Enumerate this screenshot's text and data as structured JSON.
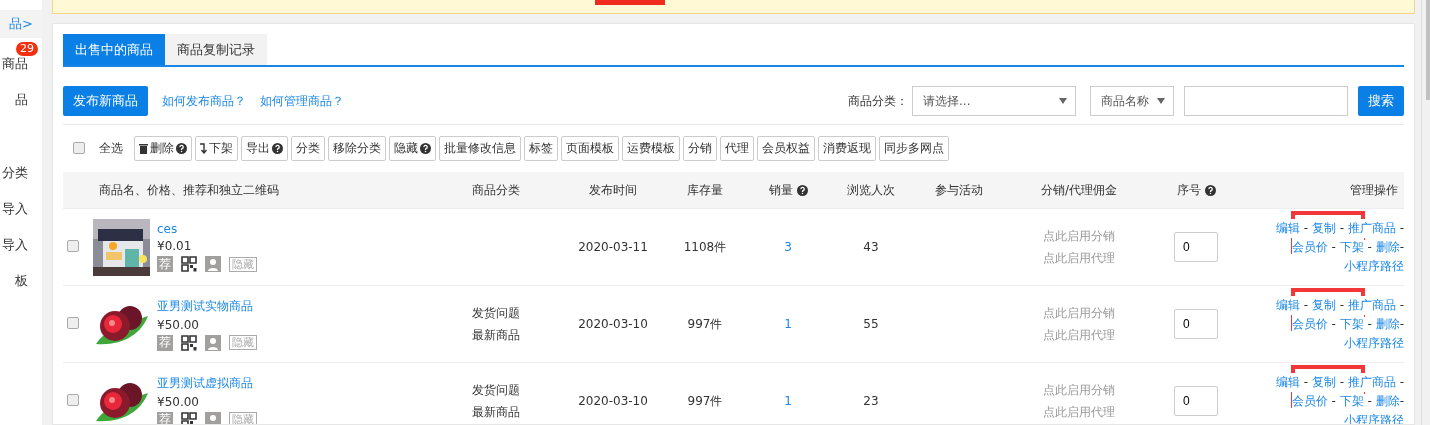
{
  "sidebar": {
    "items": [
      {
        "label": "品>",
        "selected": true
      },
      {
        "label": "商品",
        "selected": false,
        "badge": "29"
      },
      {
        "label": "品",
        "selected": false
      },
      {
        "label": "分类",
        "selected": false
      },
      {
        "label": "导入",
        "selected": false
      },
      {
        "label": "导入",
        "selected": false
      },
      {
        "label": "板",
        "selected": false
      }
    ]
  },
  "banner": {
    "marked": true
  },
  "tabs": [
    {
      "label": "出售中的商品",
      "selected": true
    },
    {
      "label": "商品复制记录",
      "selected": false
    }
  ],
  "actions": {
    "publish_button": "发布新商品",
    "links": [
      "如何发布商品？",
      "如何管理商品？"
    ]
  },
  "filters": {
    "category_label": "商品分类：",
    "category_select": "请选择...",
    "field_select": "商品名称",
    "search_button": "搜索"
  },
  "toolbar": {
    "select_all": {
      "label": "全选",
      "checked": false
    },
    "buttons": [
      {
        "label": "删除",
        "kind": "delete",
        "help": true
      },
      {
        "label": "下架",
        "kind": "unshelve"
      },
      {
        "label": "导出",
        "kind": "plain",
        "help": true
      },
      {
        "label": "分类",
        "kind": "plain"
      },
      {
        "label": "移除分类",
        "kind": "plain"
      },
      {
        "label": "隐藏",
        "kind": "plain",
        "help": true
      },
      {
        "label": "批量修改信息",
        "kind": "plain"
      },
      {
        "label": "标签",
        "kind": "plain"
      },
      {
        "label": "页面模板",
        "kind": "plain"
      },
      {
        "label": "运费模板",
        "kind": "plain"
      },
      {
        "label": "分销",
        "kind": "plain"
      },
      {
        "label": "代理",
        "kind": "plain"
      },
      {
        "label": "会员权益",
        "kind": "plain"
      },
      {
        "label": "消费返现",
        "kind": "plain"
      },
      {
        "label": "同步多网点",
        "kind": "plain"
      }
    ]
  },
  "table": {
    "columns": [
      {
        "label": "商品名、价格、推荐和独立二维码"
      },
      {
        "label": "商品分类"
      },
      {
        "label": "发布时间"
      },
      {
        "label": "库存量"
      },
      {
        "label": "销量",
        "help": true
      },
      {
        "label": "浏览人次"
      },
      {
        "label": "参与活动"
      },
      {
        "label": "分销/代理佣金"
      },
      {
        "label": "序号",
        "help": true
      },
      {
        "label": "管理操作"
      }
    ],
    "rows": [
      {
        "checked": false,
        "image": {
          "kind": "picture"
        },
        "name": "ces",
        "price": "¥0.01",
        "recommend": "荐",
        "hidden_tag": "隐藏",
        "categories": [],
        "date": "2020-03-11",
        "stock": "1108件",
        "sales": "3",
        "views": "43",
        "commission": [
          "点此启用分销",
          "点此启用代理"
        ],
        "order": "0",
        "operations": [
          "编辑",
          " - ",
          "复制",
          " - ",
          "推广商品",
          " - ",
          "会员价",
          " - ",
          "下架",
          " - ",
          "删除",
          "- ",
          "小程序路径"
        ],
        "highlighted": true
      },
      {
        "checked": false,
        "image": {
          "kind": "picture"
        },
        "name": "亚男测试实物商品",
        "price": "¥50.00",
        "recommend": "荐",
        "hidden_tag": "隐藏",
        "categories": [
          "发货问题",
          "最新商品"
        ],
        "date": "2020-03-10",
        "stock": "997件",
        "sales": "1",
        "views": "55",
        "commission": [
          "点此启用分销",
          "点此启用代理"
        ],
        "order": "0",
        "operations": [
          "编辑",
          " - ",
          "复制",
          " - ",
          "推广商品",
          " - ",
          "会员价",
          " - ",
          "下架",
          " - ",
          "删除",
          "- ",
          "小程序路径"
        ],
        "highlighted": true
      },
      {
        "checked": false,
        "image": {
          "kind": "picture"
        },
        "name": "亚男测试虚拟商品",
        "price": "¥50.00",
        "recommend": "荐",
        "hidden_tag": "隐藏",
        "categories": [
          "发货问题",
          "最新商品"
        ],
        "date": "2020-03-10",
        "stock": "997件",
        "sales": "1",
        "views": "23",
        "commission": [
          "点此启用分销",
          "点此启用代理"
        ],
        "order": "0",
        "operations": [
          "编辑",
          " - ",
          "复制",
          " - ",
          "推广商品",
          " - ",
          "会员价",
          " - ",
          "下架",
          " - ",
          "删除",
          "- ",
          "小程序路径"
        ],
        "highlighted": true
      }
    ]
  }
}
